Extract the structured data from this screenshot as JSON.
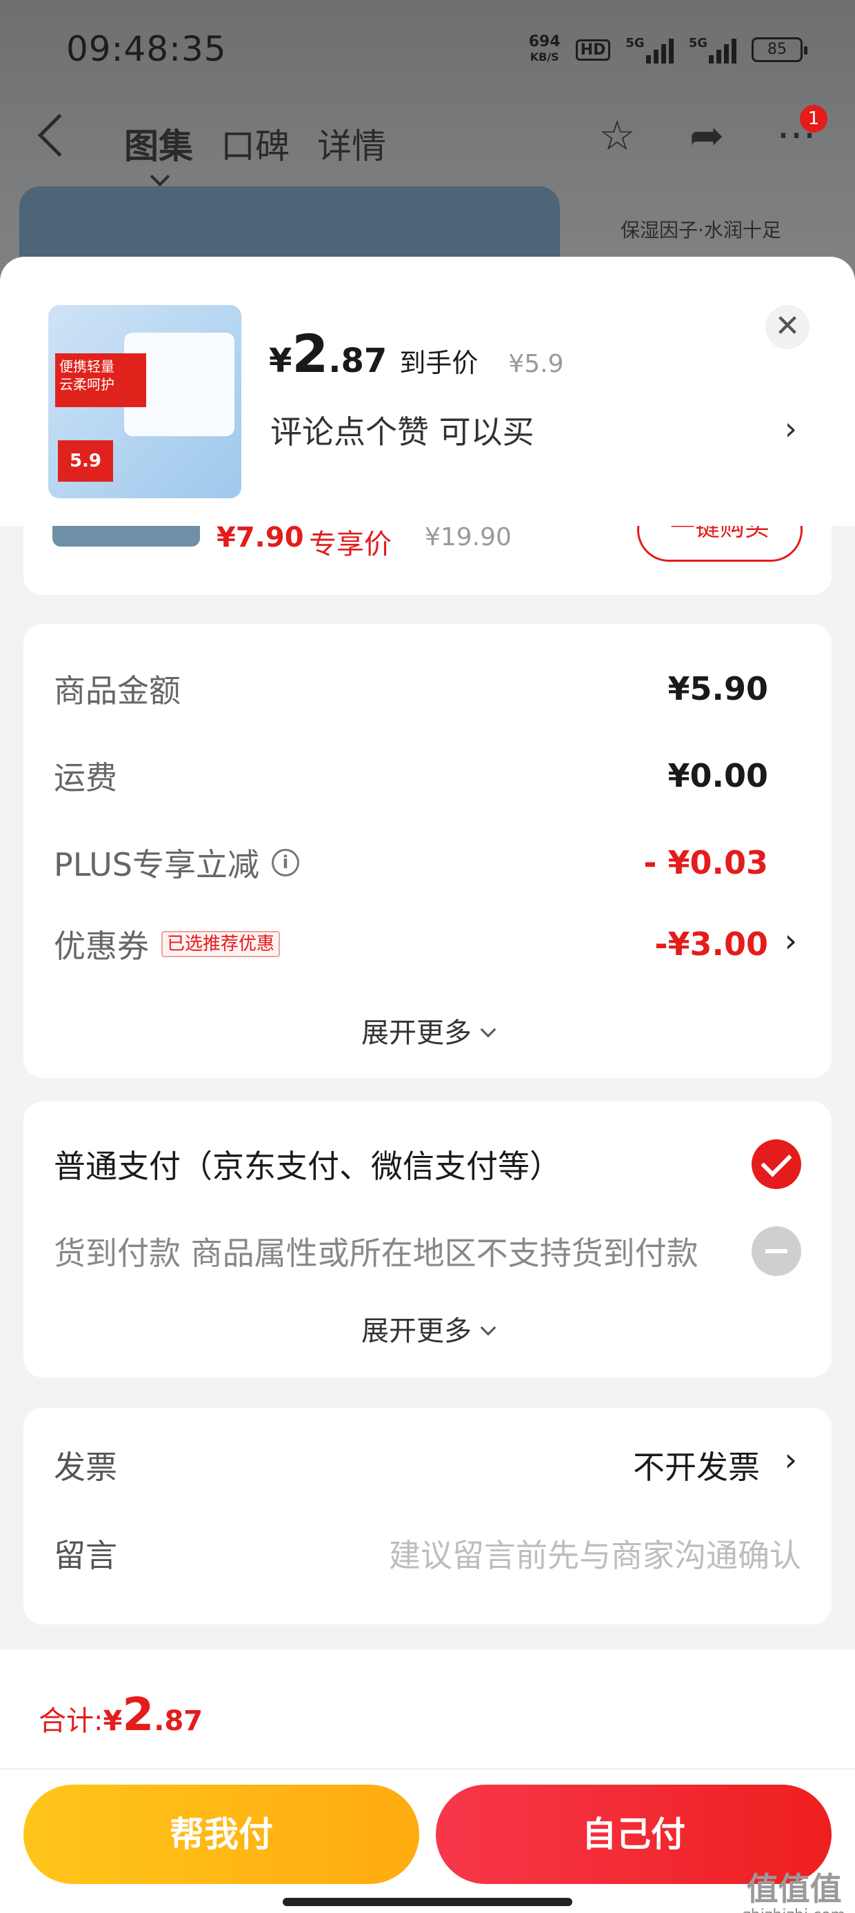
{
  "status_bar": {
    "time": "09:48:35",
    "speed_value": "694",
    "speed_unit": "KB/S",
    "hd": "HD",
    "net1": "5G",
    "net2": "5G",
    "battery": "85"
  },
  "nav": {
    "tabs": [
      "图集",
      "口碑",
      "详情"
    ],
    "badge": "1"
  },
  "background": {
    "caption": "保湿因子·水润十足"
  },
  "product": {
    "price_currency": "¥",
    "price_int": "2",
    "price_dec": ".87",
    "price_label": "到手价",
    "original_price": "¥5.9",
    "promo_text": "评论点个赞  可以买",
    "thumb_text_1": "便携轻量",
    "thumb_text_2": "云柔呵护",
    "thumb_price": "5.9"
  },
  "partial_item": {
    "price": "¥7.90",
    "tag": "专享价",
    "original": "¥19.90",
    "button": "一键购买"
  },
  "amounts": {
    "goods_label": "商品金额",
    "goods_value": "¥5.90",
    "shipping_label": "运费",
    "shipping_value": "¥0.00",
    "plus_label": "PLUS专享立减",
    "plus_value": "- ¥0.03",
    "coupon_label": "优惠券",
    "coupon_tag": "已选推荐优惠",
    "coupon_value": "-¥3.00",
    "more": "展开更多"
  },
  "payment": {
    "normal": "普通支付（京东支付、微信支付等）",
    "cod": "货到付款 商品属性或所在地区不支持货到付款",
    "more": "展开更多"
  },
  "invoice": {
    "invoice_label": "发票",
    "invoice_value": "不开发票",
    "message_label": "留言",
    "message_placeholder": "建议留言前先与商家沟通确认"
  },
  "bottom": {
    "total_label": "合计: ",
    "total_currency": "¥",
    "total_int": "2",
    "total_dec": ".87",
    "help_pay": "帮我付",
    "self_pay": "自己付",
    "watermark_big": "值值值",
    "watermark_small": "zhizhizhi.com"
  },
  "colors": {
    "accent": "#e41c1c",
    "help_button": "#ffb714",
    "self_button": "#f02a35"
  }
}
